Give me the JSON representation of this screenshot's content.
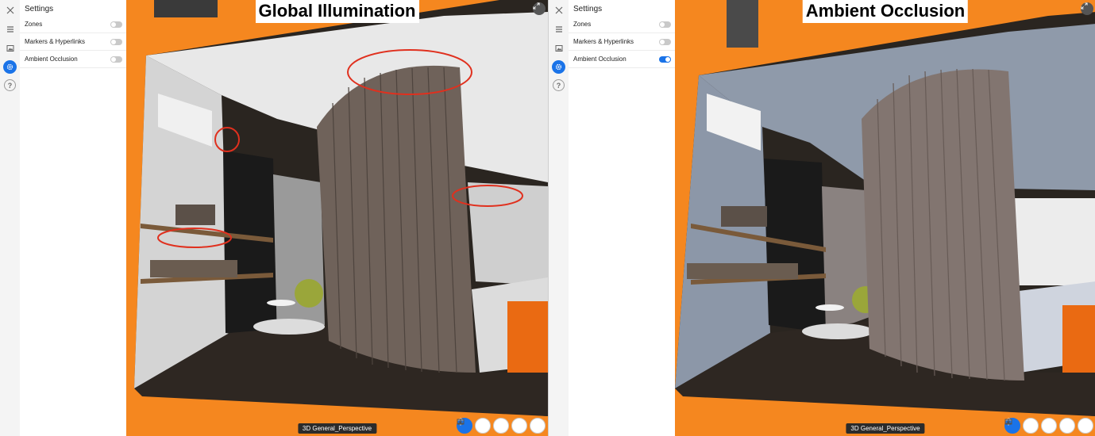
{
  "settings": {
    "title": "Settings",
    "items": [
      {
        "label": "Zones"
      },
      {
        "label": "Markers & Hyperlinks"
      },
      {
        "label": "Ambient Occlusion"
      }
    ]
  },
  "panels": [
    {
      "caption": "Global Illumination",
      "view_label": "3D General_Perspective",
      "ambient_occlusion_on": false
    },
    {
      "caption": "Ambient Occlusion",
      "view_label": "3D General_Perspective",
      "ambient_occlusion_on": true
    }
  ],
  "icons": {
    "close": "close-icon",
    "list": "list-icon",
    "image": "image-icon",
    "gear": "gear-icon",
    "help": "?"
  },
  "colors": {
    "accent": "#1a73e8",
    "frame_orange": "#f5871f",
    "highlight_red": "#e0301e"
  }
}
